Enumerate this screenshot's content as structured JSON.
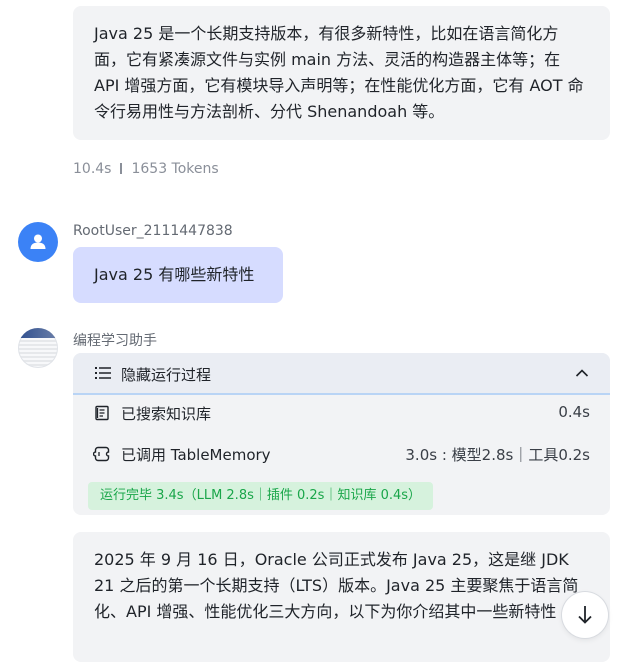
{
  "messages": {
    "prev_answer": {
      "text": "Java 25 是一个长期支持版本，有很多新特性，比如在语言简化方面，它有紧凑源文件与实例 main 方法、灵活的构造器主体等；在 API 增强方面，它有模块导入声明等；在性能优化方面，它有 AOT 命令行易用性与方法剖析、分代 Shenandoah 等。",
      "duration": "10.4s",
      "tokens": "1653 Tokens"
    },
    "user": {
      "name": "RootUser_2111447838",
      "text": "Java 25 有哪些新特性"
    },
    "assistant": {
      "name": "编程学习助手",
      "run_process": {
        "toggle_label": "隐藏运行过程",
        "steps": [
          {
            "label": "已搜索知识库",
            "time": "0.4s",
            "icon": "document-icon"
          },
          {
            "label": "已调用 TableMemory",
            "time": "3.0s : 模型2.8s｜工具0.2s",
            "icon": "plugin-icon"
          }
        ],
        "summary": "运行完毕 3.4s（LLM 2.8s｜插件 0.2s｜知识库 0.4s）"
      },
      "answer_text": "2025 年 9 月 16 日，Oracle 公司正式发布 Java 25，这是继 JDK 21 之后的第一个长期支持（LTS）版本。Java 25 主要聚焦于语言简化、API 增强、性能优化三大方向，以下为你介绍其中一些新特性"
    }
  },
  "colors": {
    "accent": "#3b82f6",
    "user_bubble": "#d6dcff",
    "success_bg": "#d6f2dd",
    "success_text": "#1aa64a"
  }
}
